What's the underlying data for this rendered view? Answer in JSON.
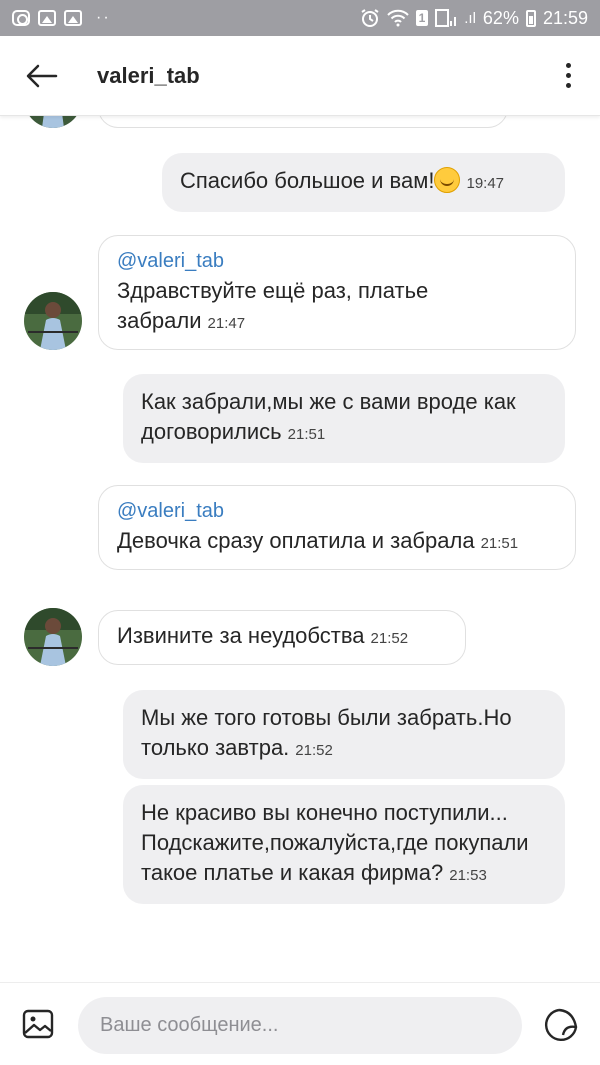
{
  "status_bar": {
    "battery": "62%",
    "time": "21:59",
    "sim": "1",
    "left_icons": [
      "instagram-icon",
      "image-icon",
      "image-icon"
    ],
    "right_icons": [
      "alarm-icon",
      "wifi-icon",
      "sim-icon",
      "signal-icon",
      "battery-icon"
    ]
  },
  "header": {
    "title": "valeri_tab",
    "back_icon": "arrow-left-icon",
    "more_icon": "more-vertical-icon"
  },
  "messages": [
    {
      "direction": "out",
      "text": "Спасибо большое и вам!",
      "emoji": "smiling-face-icon",
      "time": "19:47"
    },
    {
      "direction": "in",
      "mention": "@valeri_tab",
      "text": "Здравствуйте ещё раз, платье забрали",
      "time": "21:47",
      "avatar": true
    },
    {
      "direction": "out",
      "text": "Как забрали,мы же с вами вроде как договорились",
      "time": "21:51"
    },
    {
      "direction": "in",
      "mention": "@valeri_tab",
      "text": "Девочка сразу оплатила и забрала",
      "time": "21:51"
    },
    {
      "direction": "in",
      "text": "Извините за неудобства",
      "time": "21:52",
      "avatar": true
    },
    {
      "direction": "out",
      "text": "Мы же того готовы были забрать.Но только завтра.",
      "time": "21:52"
    },
    {
      "direction": "out",
      "text": "Не красиво вы конечно поступили... Подскажите,пожалуйста,где покупали такое платье и какая фирма?",
      "time": "21:53"
    }
  ],
  "composer": {
    "placeholder": "Ваше сообщение...",
    "gallery_icon": "image-icon",
    "sticker_icon": "sticker-icon"
  },
  "colors": {
    "status_bar": "#9e9ea3",
    "outgoing_bubble": "#efeff1",
    "mention": "#3a7dc0",
    "text": "#262626"
  }
}
